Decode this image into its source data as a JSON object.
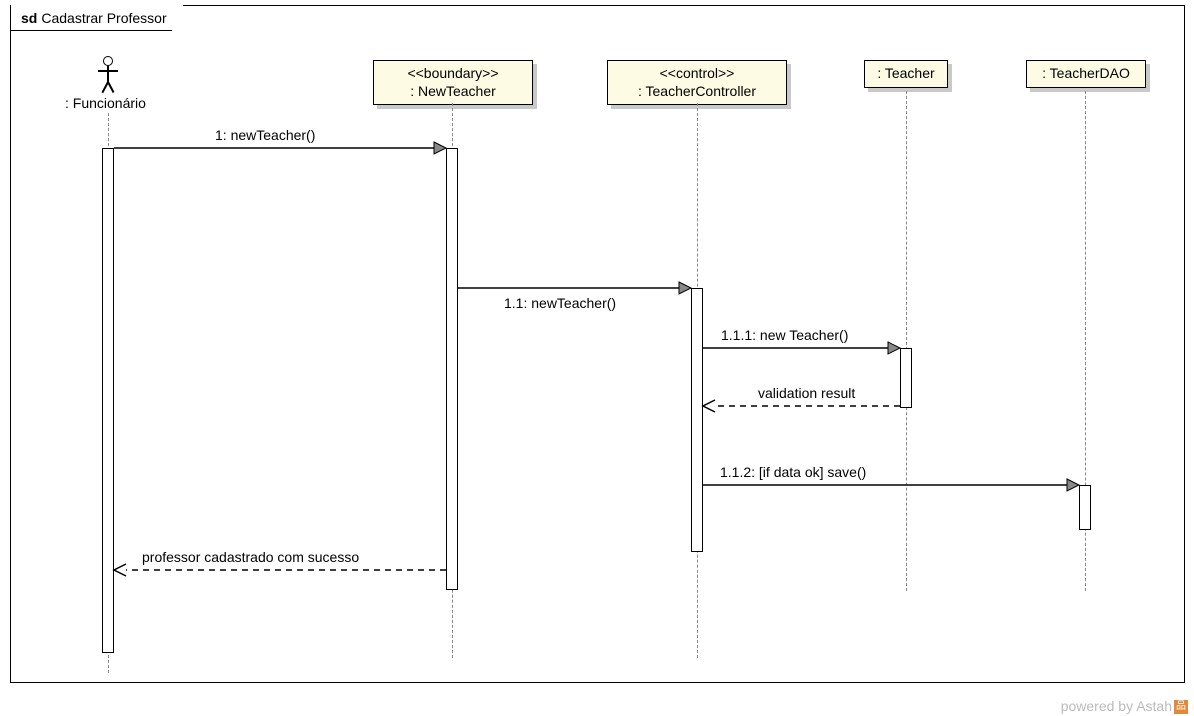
{
  "frame": {
    "prefix": "sd",
    "title": "Cadastrar Professor"
  },
  "actor": {
    "label": ": Funcionário"
  },
  "lifelines": {
    "boundary": {
      "stereotype": "<<boundary>>",
      "name": ": NewTeacher"
    },
    "control": {
      "stereotype": "<<control>>",
      "name": ": TeacherController"
    },
    "teacher": {
      "name": ": Teacher"
    },
    "teacherdao": {
      "name": ": TeacherDAO"
    }
  },
  "messages": {
    "m1": "1: newTeacher()",
    "m11": "1.1: newTeacher()",
    "m111": "1.1.1: new Teacher()",
    "r111": "validation result",
    "m112": "1.1.2: [if data ok] save()",
    "ret": "professor cadastrado com sucesso"
  },
  "footer": "powered by Astah"
}
